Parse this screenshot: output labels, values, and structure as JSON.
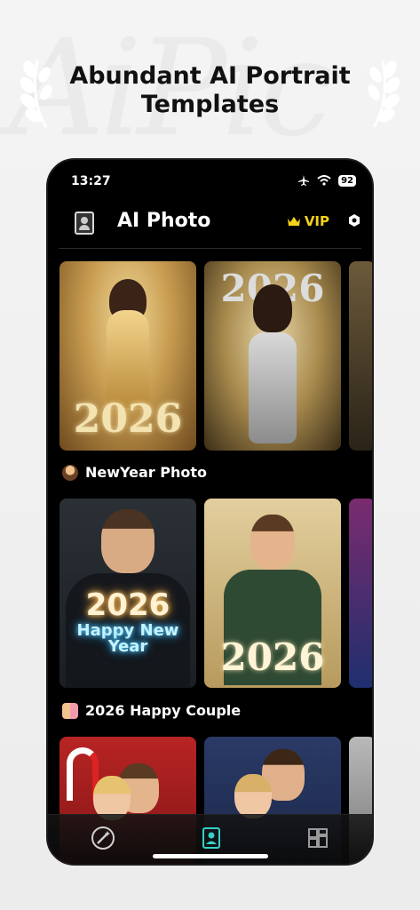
{
  "headline": {
    "line1": "Abundant AI Portrait",
    "line2": "Templates"
  },
  "status_bar": {
    "time": "13:27",
    "battery": "92",
    "icons": [
      "airplane-icon",
      "wifi-icon",
      "battery-icon"
    ]
  },
  "app_bar": {
    "title": "AI Photo",
    "vip_label": "VIP",
    "left_icon": "avatar-icon",
    "right_icon": "settings-icon"
  },
  "sections": [
    {
      "label": "NewYear Photo",
      "icon": "person-emoji-icon"
    },
    {
      "label": "2026 Happy Couple",
      "icon": "couple-emoji-icon"
    }
  ],
  "cards": {
    "row1": [
      "2026",
      "2026"
    ],
    "row2": [
      "2026",
      "Happy New",
      "Year",
      "2026"
    ],
    "row3": []
  },
  "tabbar": {
    "items": [
      "magic-wand-icon",
      "portrait-icon",
      "grid-icon"
    ],
    "active_index": 1
  },
  "colors": {
    "accent_vip": "#f6d21a",
    "active_tab": "#33d0c6",
    "background": "#000000"
  }
}
